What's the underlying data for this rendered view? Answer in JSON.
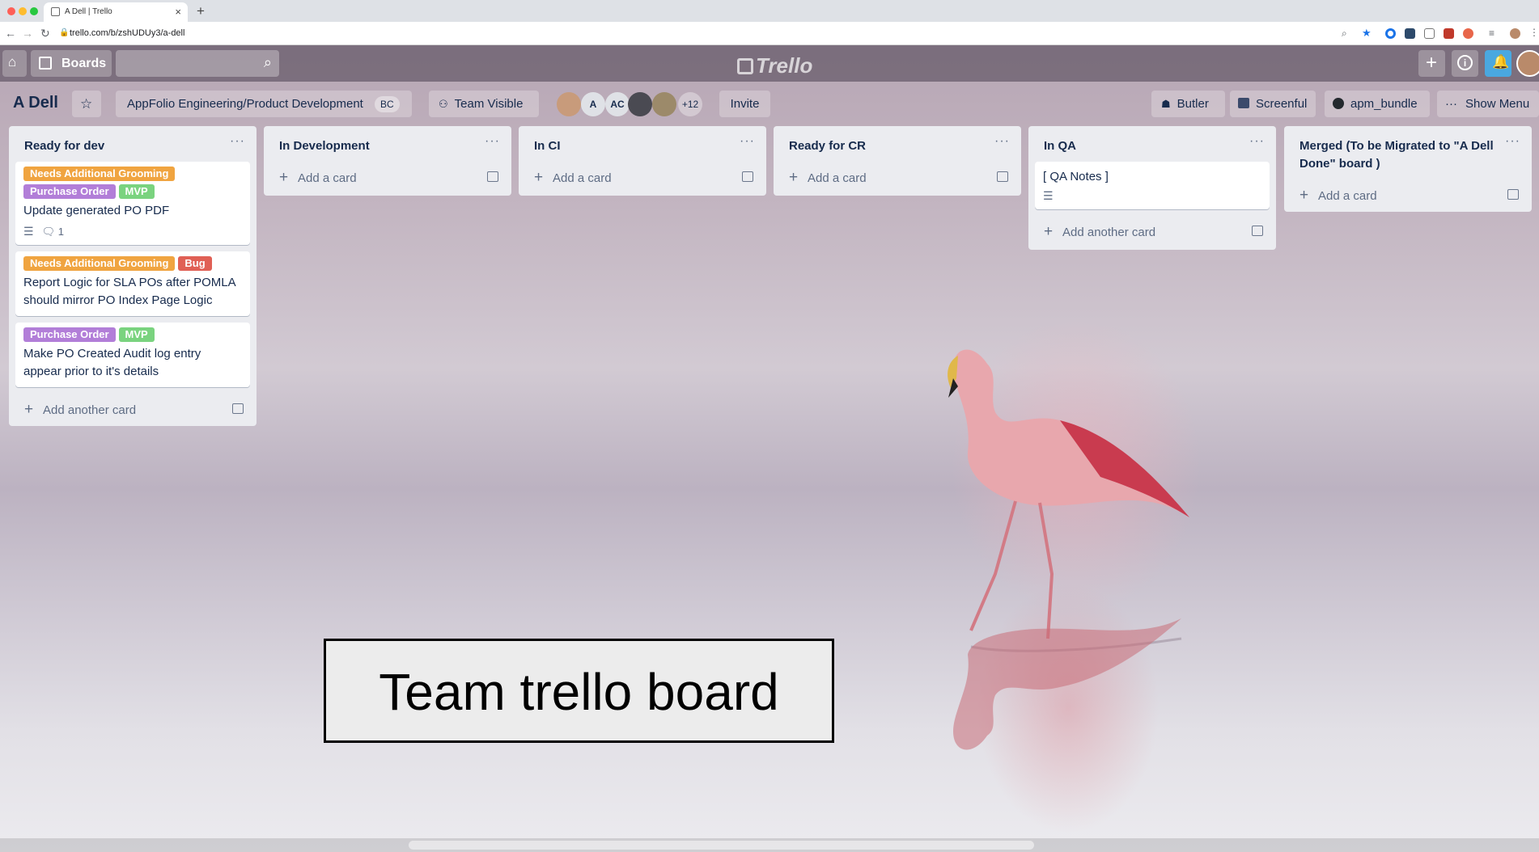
{
  "browser": {
    "tab_title": "A Dell | Trello",
    "url": "trello.com/b/zshUDUy3/a-dell"
  },
  "header": {
    "boards_label": "Boards",
    "logo_text": "Trello"
  },
  "board": {
    "title": "A Dell",
    "team": "AppFolio Engineering/Product Development",
    "team_badge": "BC",
    "visibility": "Team Visible",
    "members": [
      "A",
      "AC"
    ],
    "more_members": "+12",
    "invite": "Invite",
    "butler": "Butler",
    "screenful": "Screenful",
    "apm_bundle": "apm_bundle",
    "show_menu": "Show Menu"
  },
  "colors": {
    "orange": "#f0a440",
    "purple": "#b27ed8",
    "green": "#7ad37f",
    "red": "#e06055"
  },
  "lists": [
    {
      "title": "Ready for dev",
      "cards": [
        {
          "labels": [
            {
              "text": "Needs Additional Grooming",
              "color": "orange"
            },
            {
              "text": "Purchase Order",
              "color": "purple"
            },
            {
              "text": "MVP",
              "color": "green"
            }
          ],
          "title": "Update generated PO PDF",
          "comments": "1"
        },
        {
          "labels": [
            {
              "text": "Needs Additional Grooming",
              "color": "orange"
            },
            {
              "text": "Bug",
              "color": "red"
            }
          ],
          "title": "Report Logic for SLA POs after POMLA should mirror PO Index Page Logic"
        },
        {
          "labels": [
            {
              "text": "Purchase Order",
              "color": "purple"
            },
            {
              "text": "MVP",
              "color": "green"
            }
          ],
          "title": "Make PO Created Audit log entry appear prior to it's details"
        }
      ],
      "add_label": "Add another card"
    },
    {
      "title": "In Development",
      "cards": [],
      "add_label": "Add a card"
    },
    {
      "title": "In CI",
      "cards": [],
      "add_label": "Add a card"
    },
    {
      "title": "Ready for CR",
      "cards": [],
      "add_label": "Add a card"
    },
    {
      "title": "In QA",
      "cards": [
        {
          "labels": [],
          "title": "[ QA Notes ]"
        }
      ],
      "add_label": "Add another card"
    },
    {
      "title": "Merged (To be Migrated to \"A Dell Done\" board )",
      "cards": [],
      "add_label": "Add a card"
    }
  ],
  "caption": "Team trello board"
}
